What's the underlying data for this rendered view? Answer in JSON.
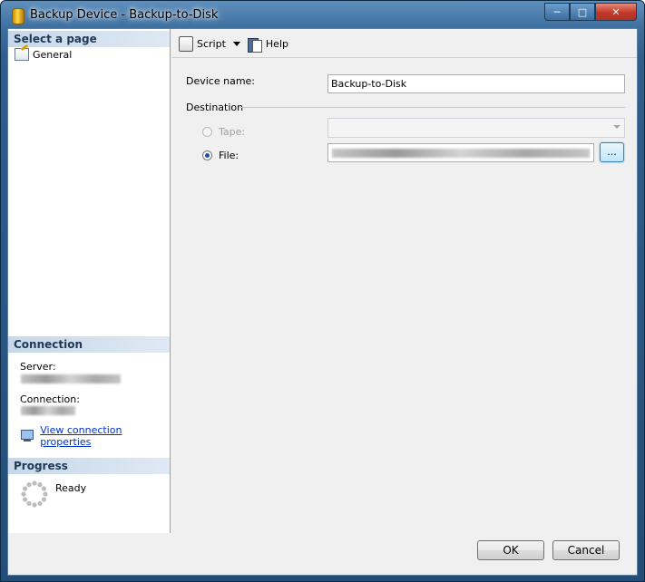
{
  "window": {
    "title": "Backup Device - Backup-to-Disk"
  },
  "left_pane": {
    "select_page_header": "Select a page",
    "pages": [
      {
        "label": "General",
        "icon": "page-properties-icon"
      }
    ],
    "connection_header": "Connection",
    "server_label": "Server:",
    "connection_label": "Connection:",
    "view_connection_link": "View connection properties",
    "progress_header": "Progress",
    "progress_status": "Ready"
  },
  "toolbar": {
    "script_label": "Script",
    "help_label": "Help"
  },
  "form": {
    "device_name_label": "Device name:",
    "device_name_value": "Backup-to-Disk",
    "destination_label": "Destination",
    "tape_label": "Tape:",
    "tape_value": "",
    "file_label": "File:",
    "selected_destination": "File",
    "browse_label": "..."
  },
  "footer": {
    "ok_label": "OK",
    "cancel_label": "Cancel"
  },
  "colors": {
    "link": "#0033cc",
    "section_header": "#c6d8ea",
    "titlebar": "#3d6f9f"
  }
}
